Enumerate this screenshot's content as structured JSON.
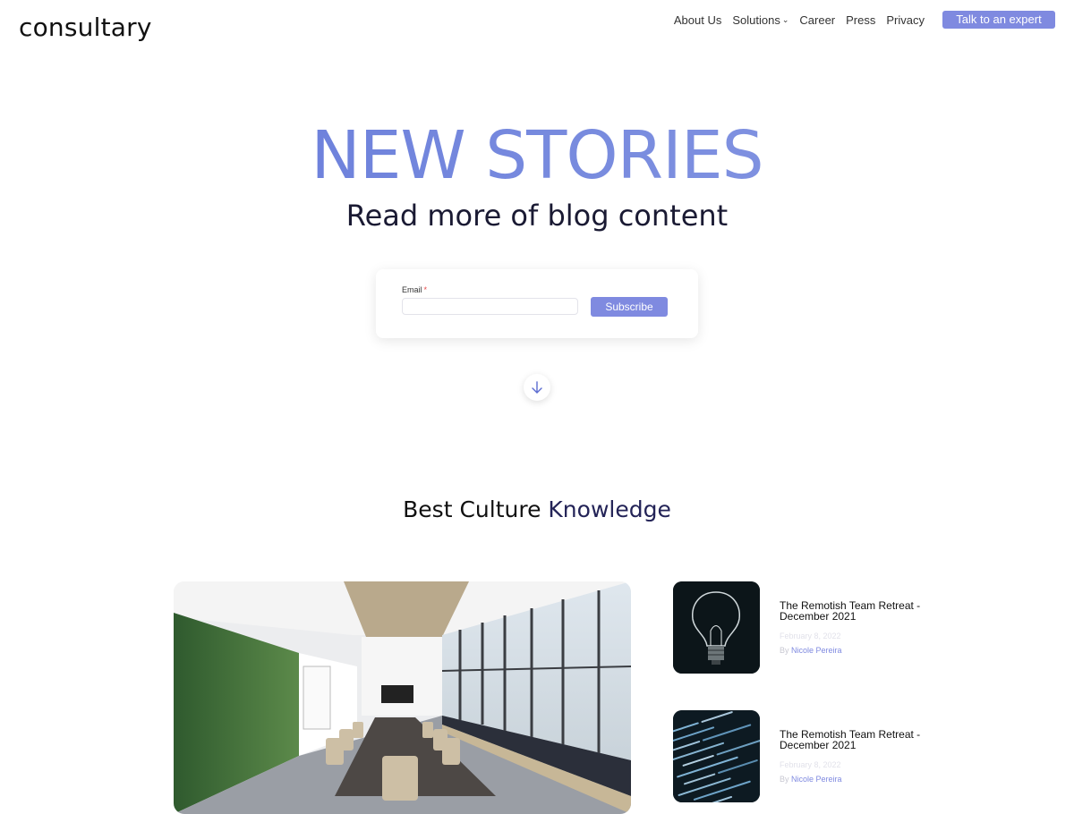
{
  "brand": {
    "logo": "consultary"
  },
  "nav": {
    "items": [
      {
        "label": "About Us"
      },
      {
        "label": "Solutions"
      },
      {
        "label": "Career"
      },
      {
        "label": "Press"
      },
      {
        "label": "Privacy"
      }
    ],
    "cta_label": "Talk to an expert"
  },
  "hero": {
    "title": "NEW STORIES",
    "subtitle": "Read more of blog content"
  },
  "subscribe": {
    "email_label": "Email",
    "required_mark": "*",
    "email_value": "",
    "button_label": "Subscribe"
  },
  "section": {
    "title_part1": "Best Culture ",
    "title_part2": "Knowledge"
  },
  "posts": [
    {
      "title": "The Remotish Team Retreat - December 2021",
      "date": "February 8, 2022",
      "author_prefix": "By ",
      "author": "Nicole Pereira",
      "thumbnail": "lightbulb"
    },
    {
      "title": "The Remotish Team Retreat - December 2021",
      "date": "February 8, 2022",
      "author_prefix": "By ",
      "author": "Nicole Pereira",
      "thumbnail": "code-screen"
    }
  ],
  "colors": {
    "accent": "#7f8ae0",
    "hero_gradient_start": "#6378d9",
    "hero_gradient_end": "#8a9be3",
    "required": "#e54848"
  }
}
